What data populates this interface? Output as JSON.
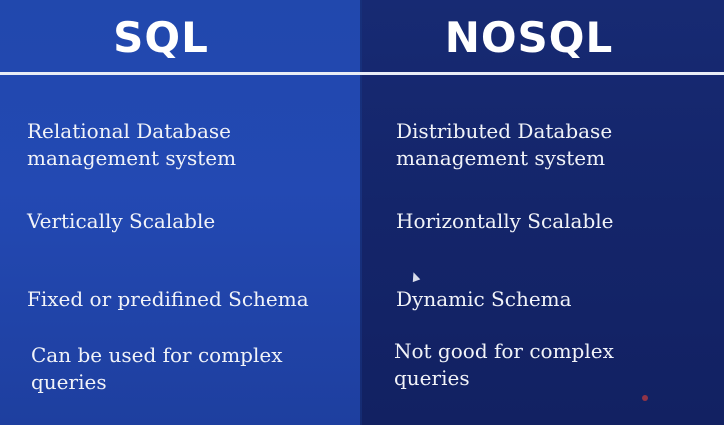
{
  "sql": {
    "title": "SQL",
    "rows": [
      "Relational Database\nmanagement system",
      "Vertically Scalable",
      "Fixed or predifined Schema",
      "Can be used for complex\nqueries"
    ]
  },
  "nosql": {
    "title": "NOSQL",
    "rows": [
      "Distributed Database\nmanagement system",
      "Horizontally Scalable",
      "Dynamic Schema",
      "Not good for complex\nqueries"
    ]
  },
  "colors": {
    "left_background": "#2349b3",
    "right_background": "#14256a",
    "divider": "#e9edf6",
    "text": "#f1f3f8"
  }
}
